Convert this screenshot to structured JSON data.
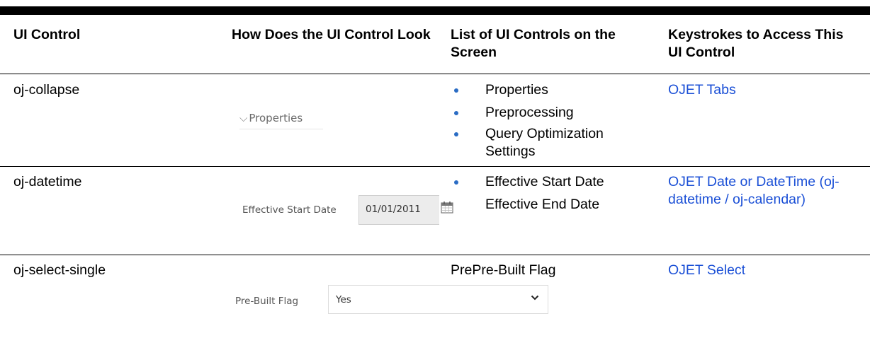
{
  "table": {
    "headers": [
      "UI Control",
      "How Does the UI Control Look",
      "List of UI Controls on the Screen",
      "Keystrokes to Access This UI Control"
    ],
    "rows": [
      {
        "control": "oj-collapse",
        "preview": {
          "chevron": "⌵",
          "label": "Properties"
        },
        "list_items": [
          "Properties",
          "Preprocessing",
          "Query Optimization Settings"
        ],
        "keystrokes_link": "OJET Tabs"
      },
      {
        "control": "oj-datetime",
        "preview": {
          "label": "Effective Start Date",
          "value": "01/01/2011",
          "icon": "calendar-icon"
        },
        "list_items": [
          "Effective Start Date",
          "Effective End Date"
        ],
        "keystrokes_link": "OJET Date or DateTime (oj-datetime / oj-calendar)"
      },
      {
        "control": "oj-select-single",
        "preview": {
          "label": "Pre-Built Flag",
          "value": "Yes",
          "icon": "chevron-down-icon"
        },
        "list_text": "PrePre-Built Flag",
        "keystrokes_link": "OJET Select"
      }
    ]
  },
  "colors": {
    "link": "#1a4fd6",
    "bullet": "#2a6cc4",
    "rule": "#000000"
  }
}
